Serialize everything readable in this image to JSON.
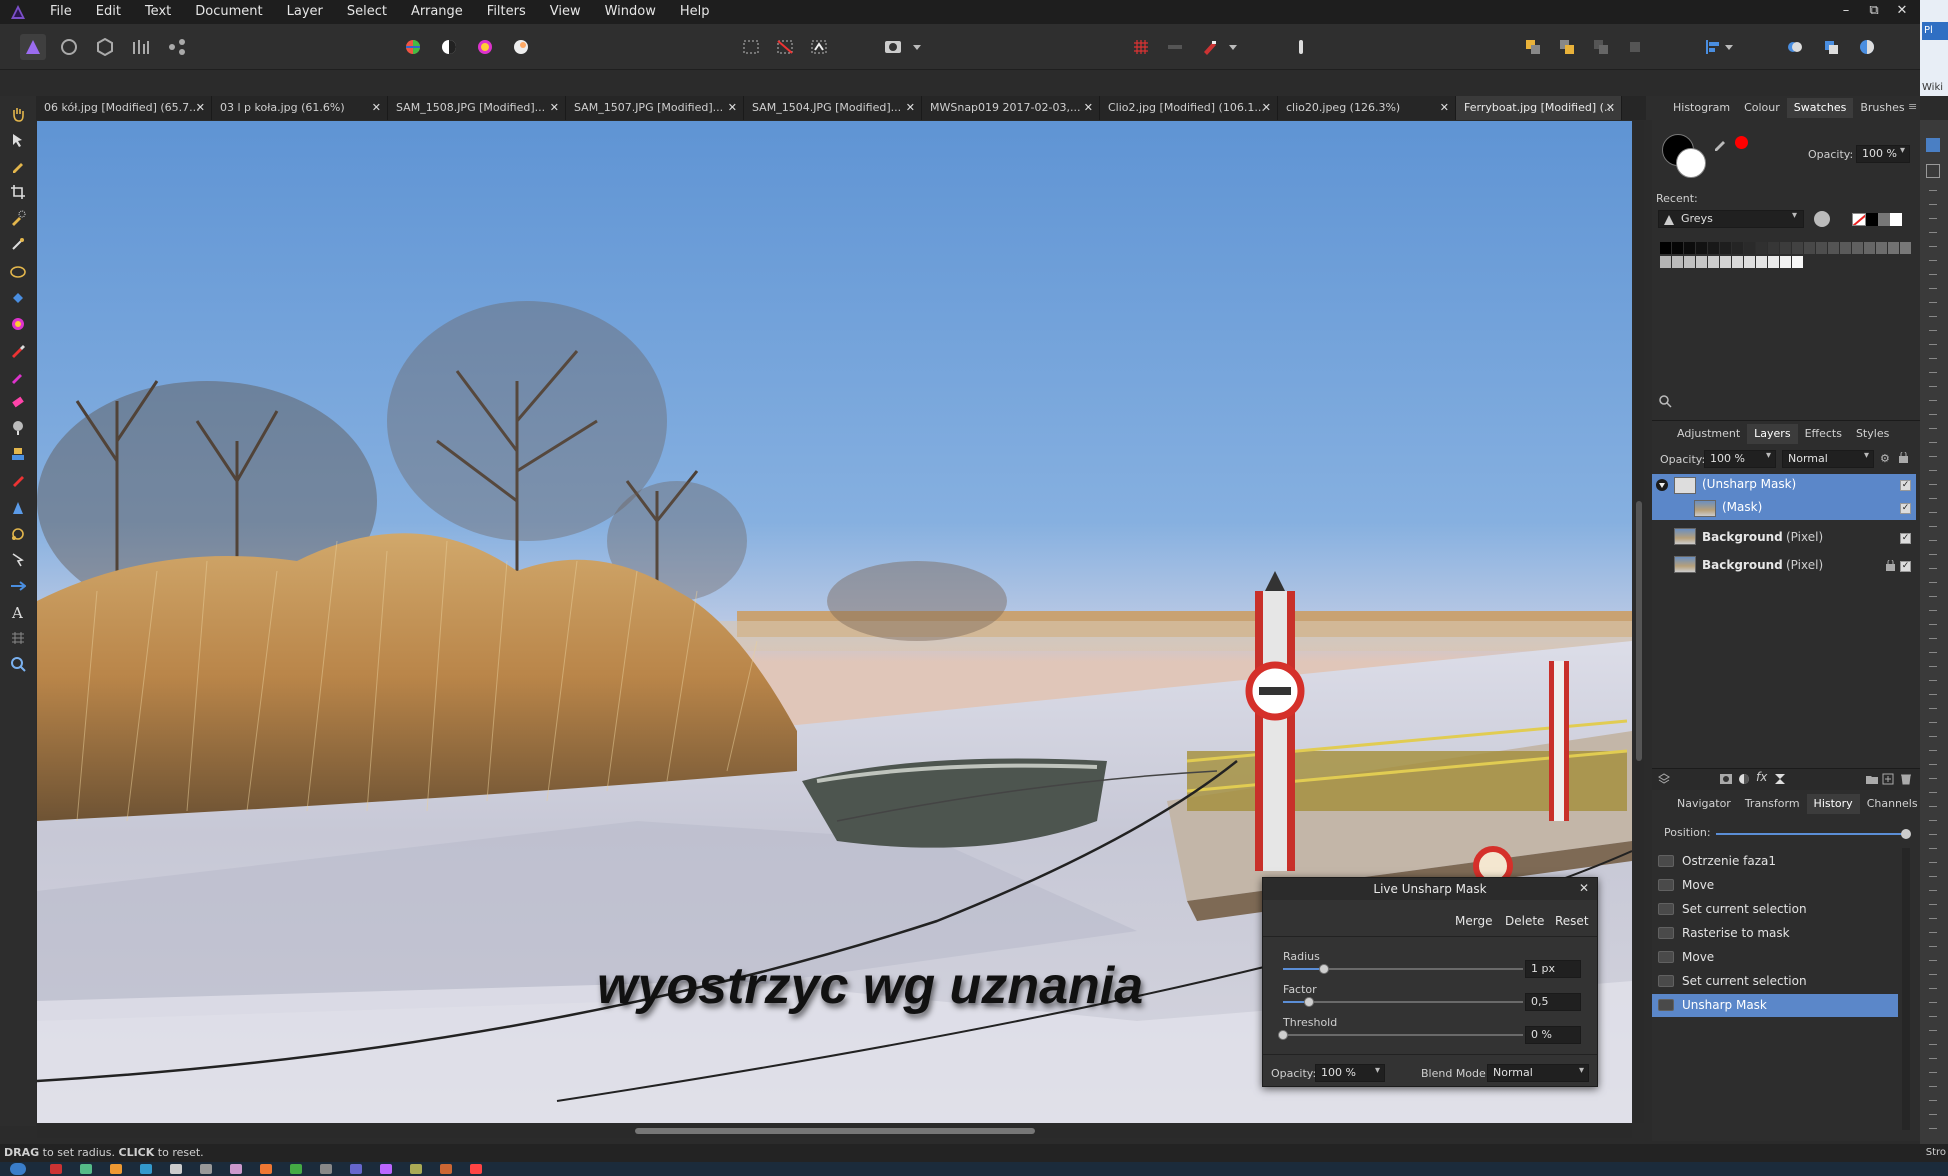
{
  "menu": {
    "items": [
      "File",
      "Edit",
      "Text",
      "Document",
      "Layer",
      "Select",
      "Arrange",
      "Filters",
      "View",
      "Window",
      "Help"
    ],
    "window_controls": [
      "–",
      "⧉",
      "✕"
    ]
  },
  "tabs": [
    {
      "label": "06 kół.jpg [Modified] (65.7...",
      "active": false
    },
    {
      "label": "03 l p koła.jpg (61.6%)",
      "active": false
    },
    {
      "label": "SAM_1508.JPG [Modified]...",
      "active": false
    },
    {
      "label": "SAM_1507.JPG [Modified]...",
      "active": false
    },
    {
      "label": "SAM_1504.JPG [Modified]...",
      "active": false
    },
    {
      "label": "MWSnap019 2017-02-03,...",
      "active": false
    },
    {
      "label": "Clio2.jpg [Modified] (106.1...",
      "active": false
    },
    {
      "label": "clio20.jpeg (126.3%)",
      "active": false
    },
    {
      "label": "Ferryboat.jpg [Modified] (...",
      "active": true
    }
  ],
  "tab_close": "✕",
  "canvas": {
    "overlay_text": "wyostrzyc wg uznania"
  },
  "swatches_panel": {
    "tabs": [
      "Histogram",
      "Colour",
      "Swatches",
      "Brushes"
    ],
    "active_tab": "Swatches",
    "opacity_label": "Opacity:",
    "opacity_value": "100 %",
    "recent_label": "Recent:",
    "palette_name": "Greys",
    "colors": {
      "primary": "#000000",
      "secondary": "#ffffff",
      "accent": "#ff0000"
    }
  },
  "layers_panel": {
    "tabs": [
      "Adjustment",
      "Layers",
      "Effects",
      "Styles"
    ],
    "active_tab": "Layers",
    "opacity_label": "Opacity:",
    "opacity_value": "100 %",
    "blend_value": "Normal",
    "layers": [
      {
        "name": "(Unsharp Mask)",
        "type": "",
        "selected": true,
        "indent": false
      },
      {
        "name": "(Mask)",
        "type": "",
        "selected": true,
        "indent": true
      },
      {
        "name": "Background",
        "type": "(Pixel)",
        "selected": false,
        "indent": false
      },
      {
        "name": "Background",
        "type": "(Pixel)",
        "selected": false,
        "indent": false
      }
    ]
  },
  "history_panel": {
    "tabs": [
      "Navigator",
      "Transform",
      "History",
      "Channels"
    ],
    "active_tab": "History",
    "position_label": "Position:",
    "position_value": 1.0,
    "items": [
      {
        "label": "Ostrzenie faza1",
        "selected": false
      },
      {
        "label": "Move",
        "selected": false
      },
      {
        "label": "Set current selection",
        "selected": false
      },
      {
        "label": "Rasterise to mask",
        "selected": false
      },
      {
        "label": "Move",
        "selected": false
      },
      {
        "label": "Set current selection",
        "selected": false
      },
      {
        "label": "Unsharp Mask",
        "selected": true
      }
    ]
  },
  "dialog": {
    "title": "Live Unsharp Mask",
    "buttons": [
      "Merge",
      "Delete",
      "Reset"
    ],
    "radius": {
      "label": "Radius",
      "value": "1 px",
      "fraction": 0.17
    },
    "factor": {
      "label": "Factor",
      "value": "0,5",
      "fraction": 0.11
    },
    "threshold": {
      "label": "Threshold",
      "value": "0 %",
      "fraction": 0.0
    },
    "opacity_label": "Opacity:",
    "opacity_value": "100 %",
    "blend_label": "Blend Mode:",
    "blend_value": "Normal"
  },
  "status": {
    "drag": "DRAG",
    "drag_text": " to set radius. ",
    "click": "CLICK",
    "click_text": " to reset."
  },
  "edge": {
    "right_top": "Pl",
    "right_label": "Wiki",
    "bottom_right": "Stro"
  }
}
